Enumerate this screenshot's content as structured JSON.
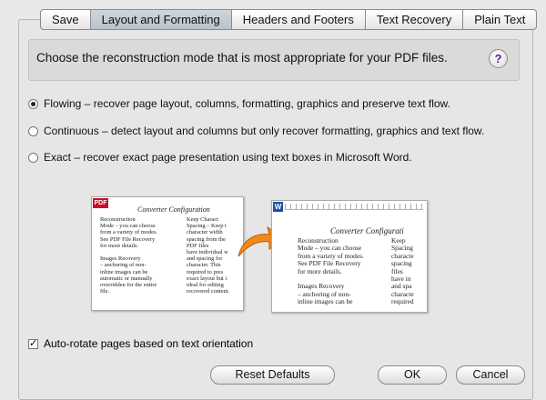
{
  "tabs": [
    {
      "label": "Save"
    },
    {
      "label": "Layout and Formatting"
    },
    {
      "label": "Headers and Footers"
    },
    {
      "label": "Text Recovery"
    },
    {
      "label": "Plain Text"
    }
  ],
  "active_tab": "Layout and Formatting",
  "header": {
    "text": "Choose the reconstruction mode that is most appropriate for your PDF files.",
    "help_label": "?"
  },
  "options": [
    {
      "label": "Flowing – recover page layout, columns, formatting, graphics and preserve text flow.",
      "selected": true
    },
    {
      "label": "Continuous – detect layout and columns but only recover formatting, graphics and text flow.",
      "selected": false
    },
    {
      "label": "Exact – recover exact page presentation using text boxes in Microsoft Word.",
      "selected": false
    }
  ],
  "preview": {
    "pdf_badge": "PDF",
    "word_badge": "W",
    "page1": {
      "title": "Converter Configuration",
      "col1": "Reconstruction\nMode – you can choose\nfrom a variety of modes.\nSee PDF File Recovery\nfor more details.\n\nImages Recovery\n– anchoring of non-\ninline images can be\nautomatic or manually\noverridden for the entire\nfile.",
      "col2": "Keep Charact\nSpacing – Keep t\ncharacter width\nspacing from the\nPDF files\nhave individual w\nand spacing for\ncharacter. This\nrequired to pres\nexact layout but i\nideal for editing\nrecovered content."
    },
    "page2": {
      "title": "Converter Configurati",
      "col1": "Reconstruction\nMode – you can choose\nfrom a variety of modes.\nSee PDF File Recovery\nfor more details.\n\nImages Recovery\n– anchoring of non-\ninline images can be",
      "col2": "Keep\nSpacing\ncharacte\nspacing\nfiles\nhave in\nand spa\ncharacte\nrequired"
    }
  },
  "auto_rotate": {
    "label": "Auto-rotate pages based on text orientation",
    "checked": true,
    "check_glyph": "✓"
  },
  "buttons": {
    "reset": "Reset Defaults",
    "ok": "OK",
    "cancel": "Cancel"
  },
  "colors": {
    "accent_help": "#5a1a8a",
    "arrow": "#f08a1c",
    "pdf_badge": "#c8102e",
    "word_badge": "#1f4fa6"
  }
}
